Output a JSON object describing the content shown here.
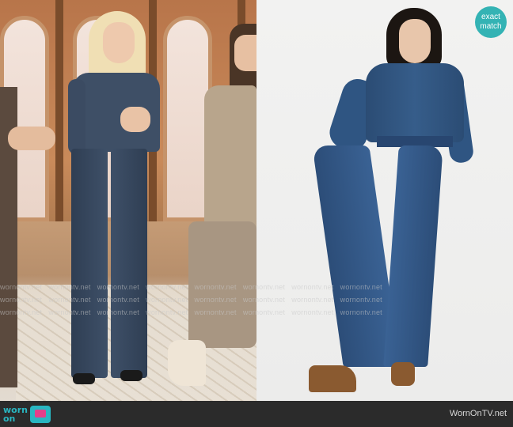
{
  "image": {
    "left_panel": "TV studio",
    "right_panel": "product photo"
  },
  "badge": {
    "line1": "exact",
    "line2": "match",
    "color": "#34b3b4"
  },
  "watermark": {
    "text": "wornontv.net",
    "color": "#c8c8c8"
  },
  "footer": {
    "logo_line1": "worn",
    "logo_line2": "on",
    "logo_line3": "tv",
    "site_name": "WornOnTV.net",
    "bar_color": "#2b2b2b",
    "logo_color": "#29b6c1"
  }
}
